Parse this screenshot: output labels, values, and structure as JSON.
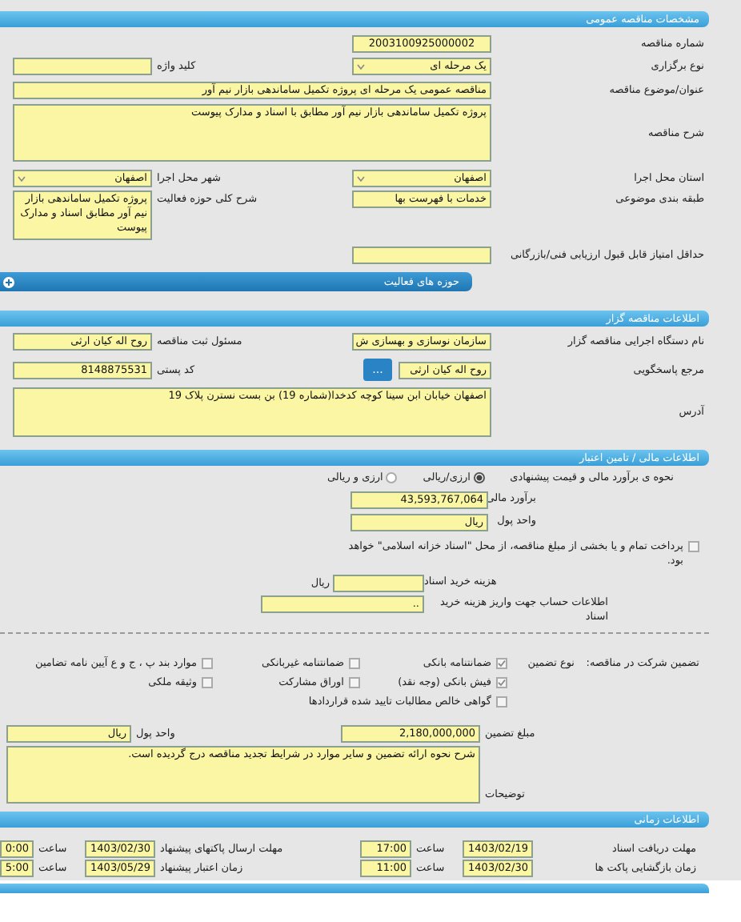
{
  "general": {
    "title": "مشخصات مناقصه عمومی",
    "tender_number": {
      "label": "شماره مناقصه",
      "value": "2003100925000002"
    },
    "holding_type": {
      "label": "نوع برگزاری",
      "value": "یک مرحله ای"
    },
    "keyword": {
      "label": "کلید واژه"
    },
    "subject": {
      "label": "عنوان/موضوع مناقصه",
      "value": "مناقصه عمومی یک مرحله ای پروژه تکمیل ساماندهی بازار نیم آور"
    },
    "description": {
      "label": "شرح مناقصه",
      "value": "پروژه تکمیل ساماندهی بازار نیم آور مطابق با اسناد و مدارک پیوست"
    },
    "province": {
      "label": "استان محل اجرا",
      "value": "اصفهان"
    },
    "city": {
      "label": "شهر محل اجرا",
      "value": "اصفهان"
    },
    "classification": {
      "label": "طبقه بندی موضوعی",
      "value": "خدمات با فهرست بها"
    },
    "activity_summary": {
      "label": "شرح کلی حوزه فعالیت",
      "value": "پروژه تکمیل ساماندهی بازار نیم آور مطابق اسناد و مدارک پیوست"
    },
    "min_score": {
      "label": "حداقل امتیاز قابل قبول ارزیابی فنی/بازرگانی"
    }
  },
  "activity_areas": {
    "title": "حوزه های فعالیت",
    "expanded": false
  },
  "organizer": {
    "title": "اطلاعات مناقصه گزار",
    "organization": {
      "label": "نام دستگاه اجرایی مناقصه گزار",
      "value": "سازمان نوسازی و بهسازی ش"
    },
    "registrar": {
      "label": "مسئول ثبت مناقصه",
      "value": "روح اله کیان ارثی"
    },
    "responder": {
      "label": "مرجع پاسخگویی",
      "value": "روح اله کیان ارثی",
      "button": "..."
    },
    "postal_code": {
      "label": "کد پستی",
      "value": "8148875531"
    },
    "address": {
      "label": "آدرس",
      "value": "اصفهان خیابان ابن سینا کوچه کدخدا(شماره 19) بن بست نسترن پلاک 19"
    }
  },
  "financial": {
    "title": "اطلاعات مالی / تامین اعتبار",
    "estimate_method": {
      "label": "نحوه ی برآورد مالی و قیمت پیشنهادی",
      "options": [
        {
          "label": "ارزی/ریالی",
          "selected": true
        },
        {
          "label": "ارزی و ریالی",
          "selected": false
        }
      ]
    },
    "estimate": {
      "label": "برآورد مالی",
      "value": "43,593,767,064"
    },
    "currency": {
      "label": "واحد پول",
      "value": "ریال"
    },
    "treasury": {
      "text": "پرداخت تمام و یا بخشی از مبلغ مناقصه، از محل \"اسناد خزانه اسلامی\" خواهد بود.",
      "checked": false
    },
    "document_cost": {
      "label": "هزینه خرید اسناد",
      "unit": "ریال"
    },
    "account_info": {
      "label": "اطلاعات حساب جهت واریز هزینه خرید اسناد",
      "value": ".."
    }
  },
  "guarantee": {
    "label": "تضمین شرکت در مناقصه:",
    "type_label": "نوع تضمین",
    "options": [
      {
        "label": "ضمانتنامه بانکی",
        "checked": true
      },
      {
        "label": "ضمانتنامه غیربانکی",
        "checked": false
      },
      {
        "label": "موارد بند پ ، ج و ع آیین نامه تضامین",
        "checked": false
      },
      {
        "label": "فیش بانکی (وجه نقد)",
        "checked": true
      },
      {
        "label": "اوراق مشارکت",
        "checked": false
      },
      {
        "label": "وثیقه ملکی",
        "checked": false
      },
      {
        "label": "گواهی خالص مطالبات تایید شده قراردادها",
        "checked": false
      }
    ],
    "amount": {
      "label": "مبلغ تضمین",
      "value": "2,180,000,000"
    },
    "currency": {
      "label": "واحد پول",
      "value": "ریال"
    },
    "notes": {
      "label": "توضیحات",
      "value": "شرح نحوه ارائه تضمین و سایر موارد در شرایط تجدید مناقصه درج گردیده است."
    }
  },
  "timing": {
    "title": "اطلاعات زمانی",
    "rows": [
      {
        "label": "مهلت دریافت اسناد",
        "date": "1403/02/19",
        "time_label": "ساعت",
        "time": "17:00"
      },
      {
        "label": "مهلت ارسال پاکتهای پیشنهاد",
        "date": "1403/02/30",
        "time_label": "ساعت",
        "time": "0:00"
      },
      {
        "label": "زمان بازگشایی پاکت ها",
        "date": "1403/02/30",
        "time_label": "ساعت",
        "time": "11:00"
      },
      {
        "label": "زمان اعتبار پیشنهاد",
        "date": "1403/05/29",
        "time_label": "ساعت",
        "time": "5:00"
      }
    ]
  }
}
